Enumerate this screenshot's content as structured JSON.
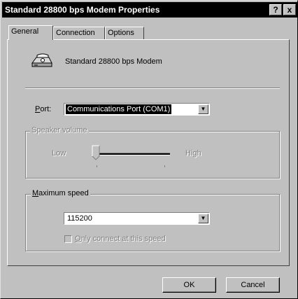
{
  "window": {
    "title": "Standard 28800 bps Modem Properties",
    "help_button": "?",
    "close_button": "x"
  },
  "tabs": [
    {
      "label": "General",
      "active": true
    },
    {
      "label": "Connection",
      "active": false
    },
    {
      "label": "Options",
      "active": false
    }
  ],
  "modem": {
    "icon": "modem-icon",
    "name": "Standard 28800 bps Modem"
  },
  "port": {
    "label_prefix": "",
    "label_hotkey": "P",
    "label_rest": "ort:",
    "value": "Communications Port (COM1)",
    "arrow": "▼"
  },
  "speaker_volume": {
    "title": "Speaker volume",
    "enabled": false,
    "low_label": "Low",
    "high_label": "High",
    "level_fraction": 0
  },
  "maximum_speed": {
    "title_hotkey": "M",
    "title_rest": "aximum speed",
    "value": "115200",
    "arrow": "▼",
    "checkbox_hotkey": "O",
    "checkbox_rest": "nly connect at this speed",
    "checkbox_checked": false,
    "checkbox_enabled": false
  },
  "buttons": {
    "ok": "OK",
    "cancel": "Cancel"
  },
  "colors": {
    "face": "#c0c0c0",
    "titlebar": "#000000",
    "selection": "#000000"
  }
}
